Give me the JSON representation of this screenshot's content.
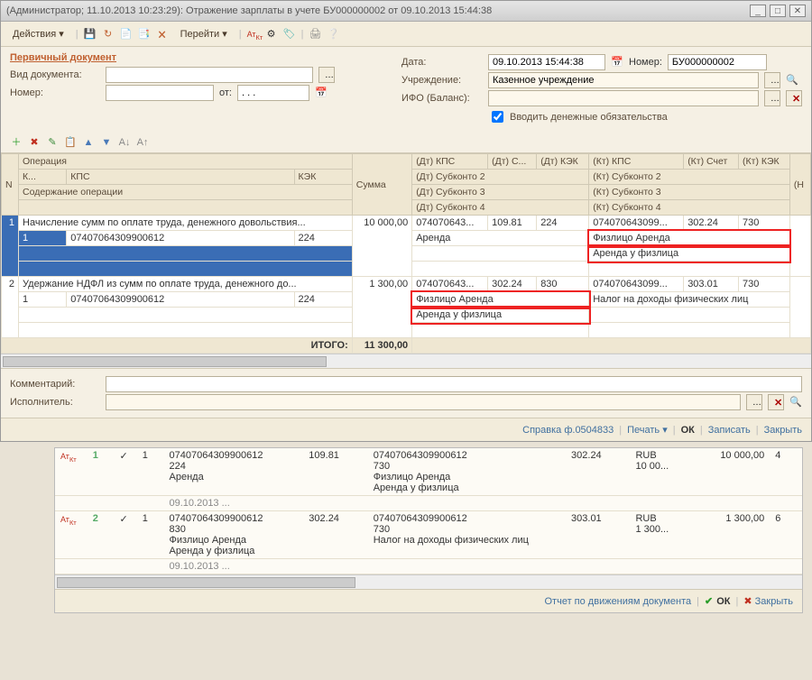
{
  "window": {
    "title": "(Администратор; 11.10.2013 10:23:29): Отражение зарплаты в учете БУ000000002 от 09.10.2013 15:44:38",
    "min": "_",
    "max": "□",
    "close": "✕"
  },
  "toolbar": {
    "actions": "Действия",
    "go": "Перейти"
  },
  "sectionTitle": "Первичный документ",
  "labels": {
    "docType": "Вид документа:",
    "number": "Номер:",
    "from": "от:",
    "date": "Дата:",
    "num": "Номер:",
    "org": "Учреждение:",
    "ifo": "ИФО (Баланс):",
    "comment": "Комментарий:",
    "executor": "Исполнитель:",
    "checkbox": "Вводить денежные обязательства"
  },
  "header": {
    "date": "09.10.2013 15:44:38",
    "number": "БУ000000002",
    "org": "Казенное учреждение",
    "fromvalue": ". . ."
  },
  "gridHeaders": {
    "n": "N",
    "op": "Операция",
    "sum": "Сумма",
    "dtKps": "(Дт) КПС",
    "dtS": "(Дт) С...",
    "dtKek": "(Дт) КЭК",
    "ktKps": "(Кт) КПС",
    "ktSchet": "(Кт) Счет",
    "ktKek": "(Кт) КЭК",
    "h2k": "К...",
    "h2kps": "КПС",
    "h2kek": "КЭК",
    "dtSub2": "(Дт) Субконто 2",
    "ktSub2": "(Кт) Субконто 2",
    "h3": "Содержание операции",
    "dtSub3": "(Дт) Субконто 3",
    "ktSub3": "(Кт) Субконто 3",
    "dtSub4": "(Дт) Субконто 4",
    "ktSub4": "(Кт) Субконто 4",
    "h_last": "(Н",
    "total": "ИТОГО:"
  },
  "rows": [
    {
      "n": "1",
      "op": "Начисление сумм по оплате труда, денежного довольствия...",
      "sum": "10 000,00",
      "dtKps": "074070643...",
      "dtS": "109.81",
      "dtKek": "224",
      "ktKps": "074070643099...",
      "ktSchet": "302.24",
      "ktKek": "730",
      "k": "1",
      "kps": "07407064309900612",
      "kek": "224",
      "dtSub2": "Аренда",
      "ktSub2": "Физлицо Аренда",
      "ktSub3": "Аренда у физлица"
    },
    {
      "n": "2",
      "op": "Удержание НДФЛ из сумм по оплате труда, денежного до...",
      "sum": "1 300,00",
      "dtKps": "074070643...",
      "dtS": "302.24",
      "dtKek": "830",
      "ktKps": "074070643099...",
      "ktSchet": "303.01",
      "ktKek": "730",
      "k": "1",
      "kps": "07407064309900612",
      "kek": "224",
      "dtSub2": "Физлицо Аренда",
      "ktSub2": "Налог на доходы физических лиц",
      "dtSub3": "Аренда у физлица"
    }
  ],
  "totals": {
    "sum": "11 300,00"
  },
  "bottomBtns": {
    "sprav": "Справка ф.0504833",
    "print": "Печать",
    "ok": "ОК",
    "save": "Записать",
    "close": "Закрыть"
  },
  "secondary": {
    "rows": [
      {
        "n": "1",
        "k": "1",
        "date": "09.10.2013 ...",
        "dtKps": "07407064309900612",
        "dtAcc": "109.81",
        "dtKek": "224",
        "ktKps": "07407064309900612",
        "ktAcc": "302.24",
        "ktKek": "730",
        "sub1": "Аренда",
        "sub2": "Физлицо Аренда",
        "sub3": "Аренда у физлица",
        "cur": "RUB",
        "amtcur": "10 00...",
        "sum": "10 000,00",
        "last": "4"
      },
      {
        "n": "2",
        "k": "1",
        "date": "09.10.2013 ...",
        "dtKps": "07407064309900612",
        "dtAcc": "302.24",
        "dtKek": "830",
        "ktKps": "07407064309900612",
        "ktAcc": "303.01",
        "ktKek": "730",
        "sub1": "Физлицо Аренда",
        "sub2": "Аренда у физлица",
        "sub3": "Налог на доходы физических лиц",
        "cur": "RUB",
        "amtcur": "1 300...",
        "sum": "1 300,00",
        "last": "6"
      }
    ],
    "reportBtn": "Отчет по движениям документа",
    "ok": "ОК",
    "close": "Закрыть"
  }
}
